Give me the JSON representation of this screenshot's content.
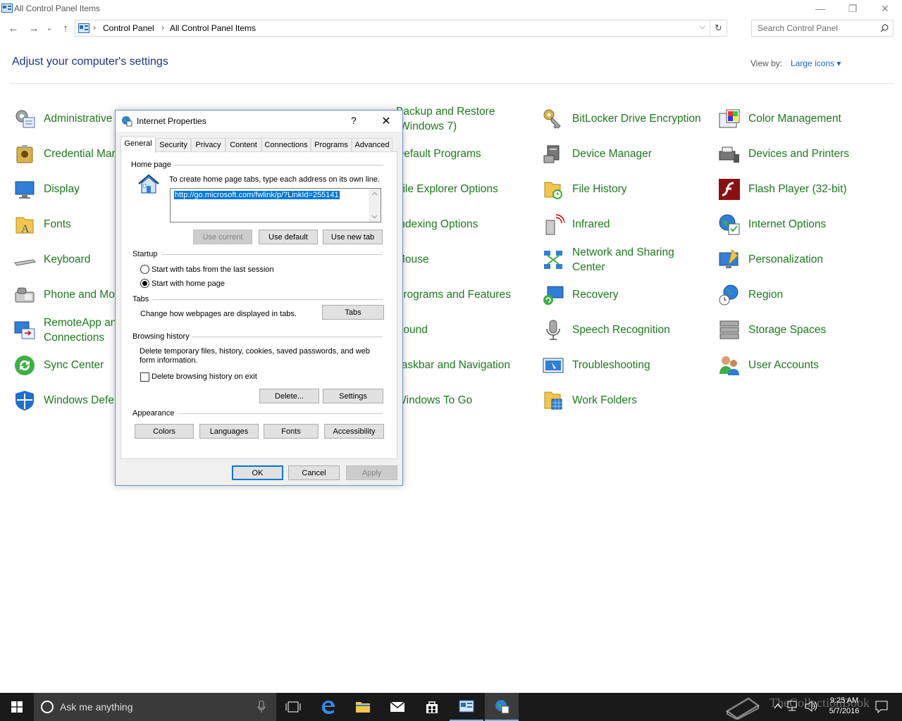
{
  "window": {
    "title": "All Control Panel Items",
    "minimize": "—",
    "restore": "❐",
    "close": "✕"
  },
  "address": {
    "crumbs": [
      "Control Panel",
      "All Control Panel Items"
    ],
    "search_placeholder": "Search Control Panel"
  },
  "header": {
    "heading": "Adjust your computer's settings",
    "view_by_label": "View by:",
    "view_by_value": "Large icons ▾"
  },
  "items": {
    "col1": [
      "Administrative",
      "Credential Mar",
      "Display",
      "Fonts",
      "Keyboard",
      "Phone and Mo",
      [
        "RemoteApp an",
        "Connections"
      ],
      "Sync Center",
      "Windows Defe"
    ],
    "col3": [
      [
        "Backup and Restore",
        "(Windows 7)"
      ],
      "Default Programs",
      "File Explorer Options",
      "Indexing Options",
      "Mouse",
      "Programs and Features",
      "Sound",
      "Taskbar and Navigation",
      "Windows To Go"
    ],
    "col4": [
      "BitLocker Drive Encryption",
      "Device Manager",
      "File History",
      "Infrared",
      [
        "Network and Sharing",
        "Center"
      ],
      "Recovery",
      "Speech Recognition",
      "Troubleshooting",
      "Work Folders"
    ],
    "col5": [
      "Color Management",
      "Devices and Printers",
      "Flash Player (32-bit)",
      "Internet Options",
      "Personalization",
      "Region",
      "Storage Spaces",
      "User Accounts"
    ]
  },
  "dialog": {
    "title": "Internet Properties",
    "help": "?",
    "close": "✕",
    "tabs": [
      "General",
      "Security",
      "Privacy",
      "Content",
      "Connections",
      "Programs",
      "Advanced"
    ],
    "home_page": {
      "label": "Home page",
      "instructions": "To create home page tabs, type each address on its own line.",
      "url": "http://go.microsoft.com/fwlink/p/?LinkId=255141",
      "use_current": "Use current",
      "use_default": "Use default",
      "use_new_tab": "Use new tab"
    },
    "startup": {
      "label": "Startup",
      "option1": "Start with tabs from the last session",
      "option2": "Start with home page"
    },
    "tabs_group": {
      "label": "Tabs",
      "text": "Change how webpages are displayed in tabs.",
      "button": "Tabs"
    },
    "browsing_history": {
      "label": "Browsing history",
      "text_line1": "Delete temporary files, history, cookies, saved passwords, and web",
      "text_line2": "form information.",
      "checkbox": "Delete browsing history on exit",
      "delete": "Delete...",
      "settings": "Settings"
    },
    "appearance": {
      "label": "Appearance",
      "colors": "Colors",
      "languages": "Languages",
      "fonts": "Fonts",
      "accessibility": "Accessibility"
    },
    "ok": "OK",
    "cancel": "Cancel",
    "apply": "Apply"
  },
  "taskbar": {
    "search_text": "Ask me anything",
    "time": "9:25 AM",
    "date": "5/7/2016",
    "watermark": "TheCollectionBook"
  }
}
